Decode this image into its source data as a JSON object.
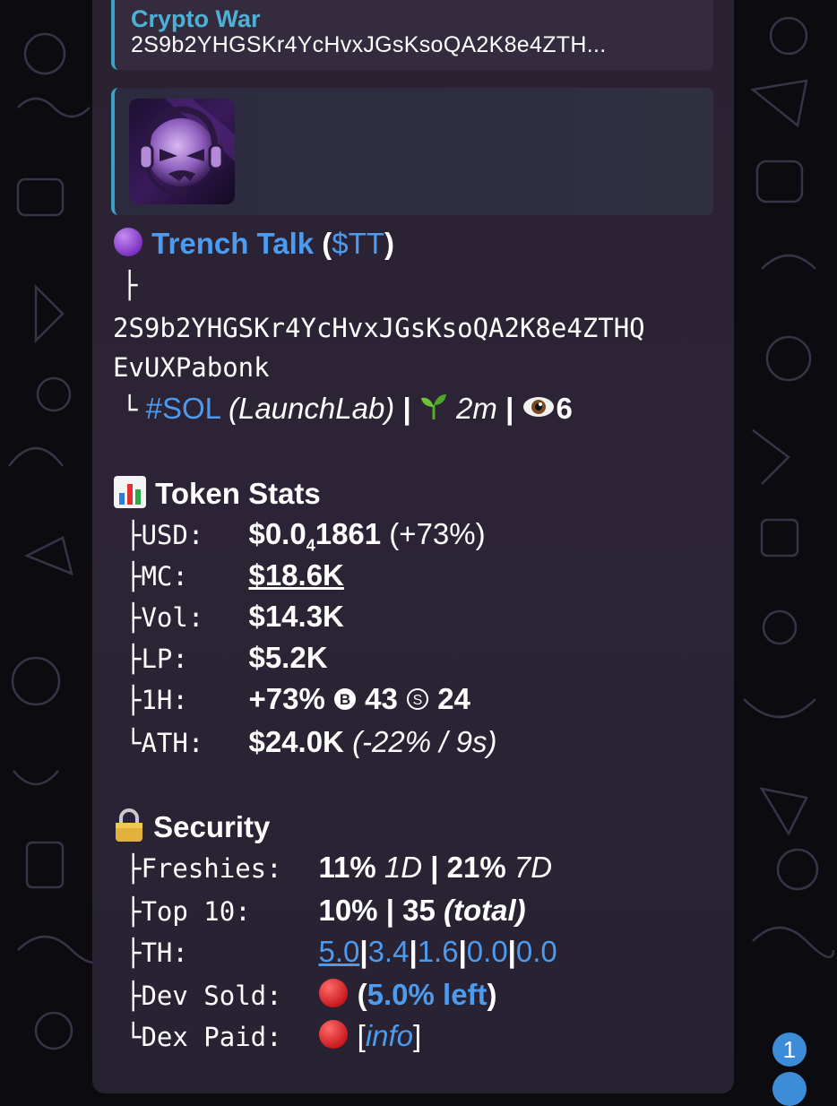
{
  "reply": {
    "title": "Crypto War",
    "text": "2S9b2YHGSKr4YcHvxJGsKsoQA2K8e4ZTH..."
  },
  "token": {
    "name": "Trench Talk",
    "open_paren": "(",
    "ticker": "$TT",
    "close_paren": ")",
    "tree_top": "├",
    "address_line1": "2S9b2YHGSKr4YcHvxJGsKsoQA2K8e4ZTHQ",
    "address_line2": "EvUXPabonk",
    "tree_bottom": "└",
    "chain": "#SOL",
    "platform": "(LaunchLab)",
    "sep": "|",
    "age": "2m",
    "views": "6"
  },
  "token_stats": {
    "heading": "Token Stats",
    "rows": [
      {
        "prefix": "├",
        "label": "USD:",
        "value_main": "$0.0",
        "value_sub": "4",
        "value_tail": "1861",
        "extra": " (+73%)"
      },
      {
        "prefix": "├",
        "label": "MC:",
        "value": "$18.6K"
      },
      {
        "prefix": "├",
        "label": "Vol:",
        "value": "$14.3K"
      },
      {
        "prefix": "├",
        "label": "LP:",
        "value": "$5.2K"
      },
      {
        "prefix": "├",
        "label": "1H:",
        "value": "+73%",
        "b_icon": "B",
        "buys": "43",
        "s_icon": "S",
        "sells": "24"
      },
      {
        "prefix": "└",
        "label": "ATH:",
        "value": "$24.0K",
        "extra": "(-22% / 9s)"
      }
    ]
  },
  "security": {
    "heading": "Security",
    "rows": [
      {
        "prefix": "├",
        "label": "Freshies:",
        "v1": "11%",
        "v1i": "1D",
        "sep": "|",
        "v2": "21%",
        "v2i": "7D"
      },
      {
        "prefix": "├",
        "label": "Top 10:",
        "v1": "10%",
        "sep": "|",
        "v2": "35",
        "v2i": "(total)"
      },
      {
        "prefix": "├",
        "label": "TH:",
        "th": [
          "5.0",
          "3.4",
          "1.6",
          "0.0",
          "0.0"
        ],
        "sep": "|"
      },
      {
        "prefix": "├",
        "label": "Dev Sold:",
        "open": "(",
        "left": "5.0% left",
        "close": ")"
      },
      {
        "prefix": "└",
        "label": "Dex Paid:",
        "open": "[",
        "info": "info",
        "close": "]"
      }
    ]
  },
  "unread_badge": "1",
  "colors": {
    "link": "#4c9bef",
    "accent_bar": "#3aa0c6",
    "bubble": "#2a2230",
    "red_dot": "#e0262b"
  }
}
